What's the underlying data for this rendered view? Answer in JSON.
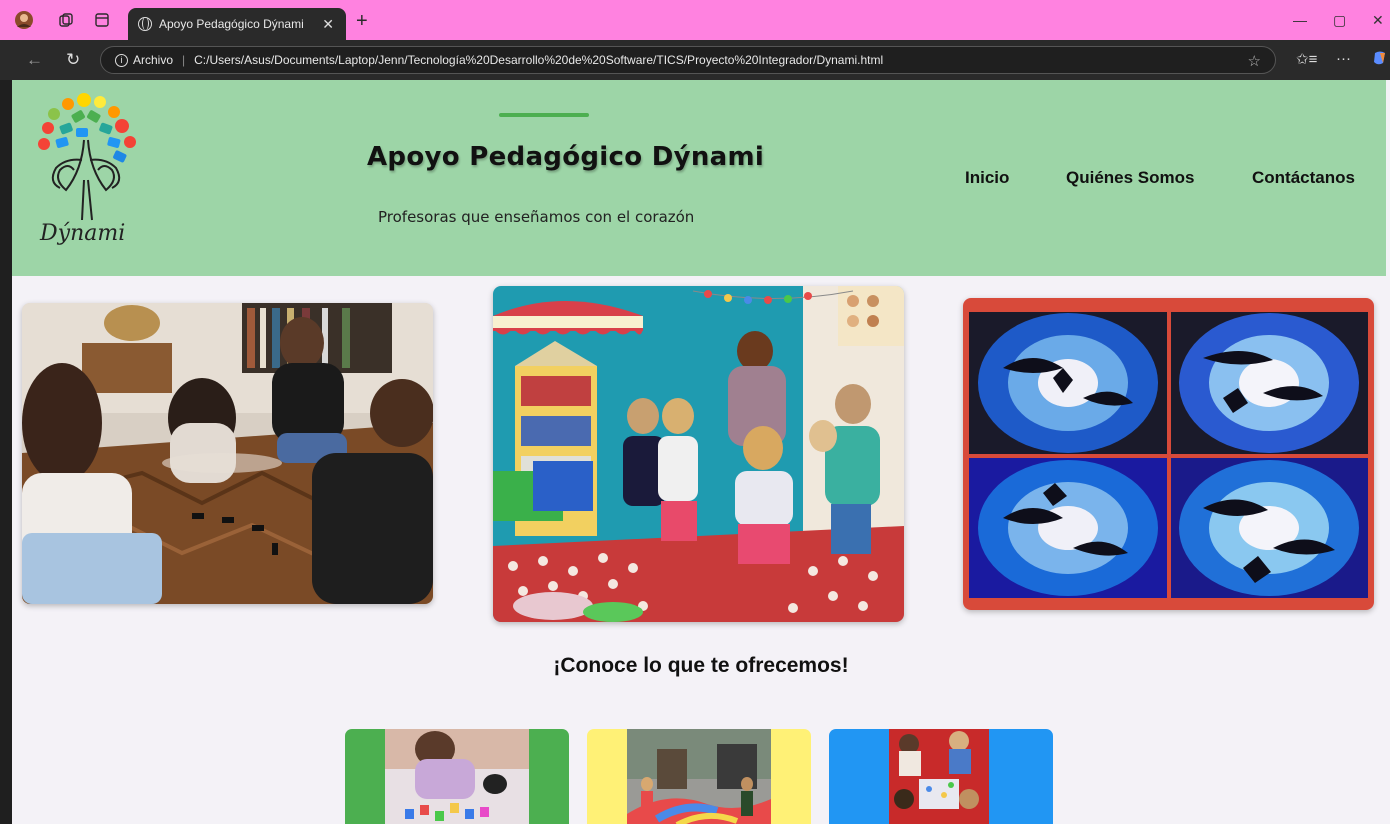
{
  "browser": {
    "tab_title": "Apoyo Pedagógico Dýnami",
    "url_prefix": "Archivo",
    "url": "C:/Users/Asus/Documents/Laptop/Jenn/Tecnolog%C3%ADa%20Desarrollo%20de%20Software/TICS/Proyecto%20Integrador/Dynami.html",
    "url_display": "C:/Users/Asus/Documents/Laptop/Jenn/Tecnología%20Desarrollo%20de%20Software/TICS/Proyecto%20Integrador/Dynami.html",
    "icons": [
      "back-icon",
      "reload-icon",
      "info-icon",
      "star-icon",
      "favorites-icon",
      "more-icon",
      "close-icon",
      "new-tab-icon"
    ]
  },
  "header": {
    "title": "Apoyo Pedagógico Dýnami",
    "subtitle": "Profesoras que enseñamos con el corazón",
    "logo_text": "Dýnami"
  },
  "nav": {
    "items": [
      {
        "label": "Inicio"
      },
      {
        "label": "Quiénes Somos"
      },
      {
        "label": "Contáctanos"
      }
    ]
  },
  "main": {
    "section_title": "¡Conoce lo que te ofrecemos!"
  },
  "colors": {
    "tab_strip": "#ff82e0",
    "header_bg": "#9dd5a7",
    "accent_green": "#4caf50",
    "card_yellow": "#fff176",
    "card_blue": "#2196f3",
    "page_bg": "#f4f2f7"
  }
}
